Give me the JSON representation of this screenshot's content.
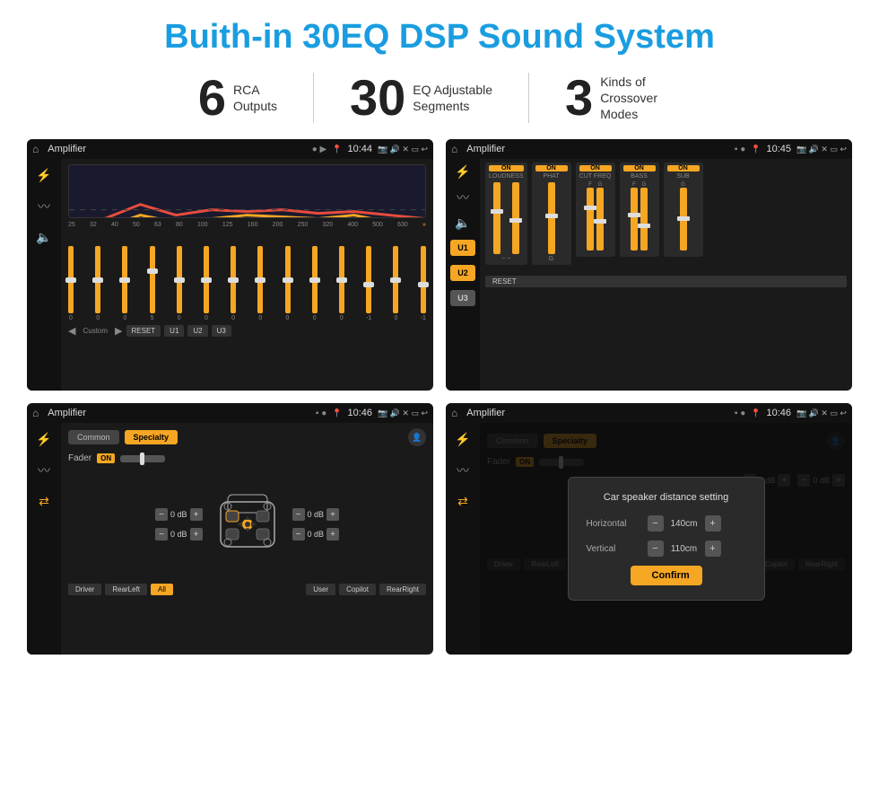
{
  "title": "Buith-in 30EQ DSP Sound System",
  "stats": [
    {
      "number": "6",
      "label": "RCA\nOutputs"
    },
    {
      "number": "30",
      "label": "EQ Adjustable\nSegments"
    },
    {
      "number": "3",
      "label": "Kinds of\nCrossover Modes"
    }
  ],
  "screens": {
    "eq": {
      "statusTitle": "Amplifier",
      "time": "10:44",
      "freqLabels": [
        "25",
        "32",
        "40",
        "50",
        "63",
        "80",
        "100",
        "125",
        "160",
        "200",
        "250",
        "320",
        "400",
        "500",
        "630"
      ],
      "sliderVals": [
        "0",
        "0",
        "0",
        "5",
        "0",
        "0",
        "0",
        "0",
        "0",
        "0",
        "0",
        "-1",
        "0",
        "-1"
      ],
      "customLabel": "Custom",
      "buttons": [
        "RESET",
        "U1",
        "U2",
        "U3"
      ]
    },
    "crossover": {
      "statusTitle": "Amplifier",
      "time": "10:45",
      "uBtns": [
        "U1",
        "U2",
        "U3"
      ],
      "controls": [
        "LOUDNESS",
        "PHAT",
        "CUT FREQ",
        "BASS",
        "SUB"
      ],
      "resetLabel": "RESET"
    },
    "fader": {
      "statusTitle": "Amplifier",
      "time": "10:46",
      "tabs": [
        "Common",
        "Specialty"
      ],
      "faderLabel": "Fader",
      "onBadge": "ON",
      "dbValues": [
        "0 dB",
        "0 dB",
        "0 dB",
        "0 dB"
      ],
      "bottomBtns": [
        "Driver",
        "RearLeft",
        "All",
        "User",
        "Copilot",
        "RearRight"
      ]
    },
    "distance": {
      "statusTitle": "Amplifier",
      "time": "10:46",
      "tabs": [
        "Common",
        "Specialty"
      ],
      "modal": {
        "title": "Car speaker distance setting",
        "horizontalLabel": "Horizontal",
        "horizontalVal": "140cm",
        "verticalLabel": "Vertical",
        "verticalVal": "110cm",
        "confirmLabel": "Confirm"
      }
    }
  }
}
